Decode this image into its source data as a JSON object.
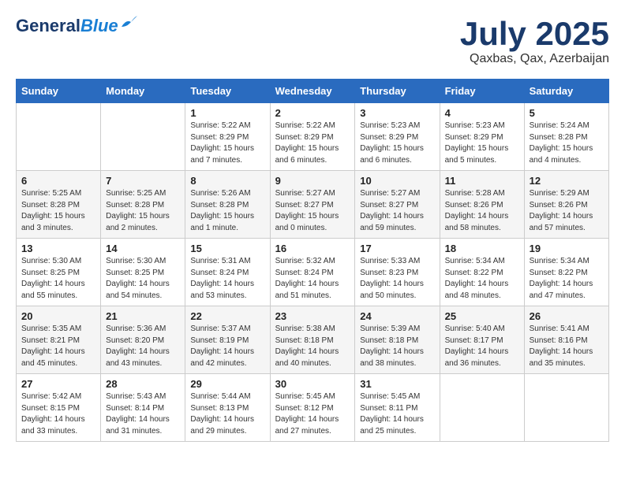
{
  "header": {
    "logo_line1": "General",
    "logo_line2": "Blue",
    "month": "July 2025",
    "location": "Qaxbas, Qax, Azerbaijan"
  },
  "weekdays": [
    "Sunday",
    "Monday",
    "Tuesday",
    "Wednesday",
    "Thursday",
    "Friday",
    "Saturday"
  ],
  "weeks": [
    [
      {
        "day": "",
        "text": ""
      },
      {
        "day": "",
        "text": ""
      },
      {
        "day": "1",
        "text": "Sunrise: 5:22 AM\nSunset: 8:29 PM\nDaylight: 15 hours and 7 minutes."
      },
      {
        "day": "2",
        "text": "Sunrise: 5:22 AM\nSunset: 8:29 PM\nDaylight: 15 hours and 6 minutes."
      },
      {
        "day": "3",
        "text": "Sunrise: 5:23 AM\nSunset: 8:29 PM\nDaylight: 15 hours and 6 minutes."
      },
      {
        "day": "4",
        "text": "Sunrise: 5:23 AM\nSunset: 8:29 PM\nDaylight: 15 hours and 5 minutes."
      },
      {
        "day": "5",
        "text": "Sunrise: 5:24 AM\nSunset: 8:28 PM\nDaylight: 15 hours and 4 minutes."
      }
    ],
    [
      {
        "day": "6",
        "text": "Sunrise: 5:25 AM\nSunset: 8:28 PM\nDaylight: 15 hours and 3 minutes."
      },
      {
        "day": "7",
        "text": "Sunrise: 5:25 AM\nSunset: 8:28 PM\nDaylight: 15 hours and 2 minutes."
      },
      {
        "day": "8",
        "text": "Sunrise: 5:26 AM\nSunset: 8:28 PM\nDaylight: 15 hours and 1 minute."
      },
      {
        "day": "9",
        "text": "Sunrise: 5:27 AM\nSunset: 8:27 PM\nDaylight: 15 hours and 0 minutes."
      },
      {
        "day": "10",
        "text": "Sunrise: 5:27 AM\nSunset: 8:27 PM\nDaylight: 14 hours and 59 minutes."
      },
      {
        "day": "11",
        "text": "Sunrise: 5:28 AM\nSunset: 8:26 PM\nDaylight: 14 hours and 58 minutes."
      },
      {
        "day": "12",
        "text": "Sunrise: 5:29 AM\nSunset: 8:26 PM\nDaylight: 14 hours and 57 minutes."
      }
    ],
    [
      {
        "day": "13",
        "text": "Sunrise: 5:30 AM\nSunset: 8:25 PM\nDaylight: 14 hours and 55 minutes."
      },
      {
        "day": "14",
        "text": "Sunrise: 5:30 AM\nSunset: 8:25 PM\nDaylight: 14 hours and 54 minutes."
      },
      {
        "day": "15",
        "text": "Sunrise: 5:31 AM\nSunset: 8:24 PM\nDaylight: 14 hours and 53 minutes."
      },
      {
        "day": "16",
        "text": "Sunrise: 5:32 AM\nSunset: 8:24 PM\nDaylight: 14 hours and 51 minutes."
      },
      {
        "day": "17",
        "text": "Sunrise: 5:33 AM\nSunset: 8:23 PM\nDaylight: 14 hours and 50 minutes."
      },
      {
        "day": "18",
        "text": "Sunrise: 5:34 AM\nSunset: 8:22 PM\nDaylight: 14 hours and 48 minutes."
      },
      {
        "day": "19",
        "text": "Sunrise: 5:34 AM\nSunset: 8:22 PM\nDaylight: 14 hours and 47 minutes."
      }
    ],
    [
      {
        "day": "20",
        "text": "Sunrise: 5:35 AM\nSunset: 8:21 PM\nDaylight: 14 hours and 45 minutes."
      },
      {
        "day": "21",
        "text": "Sunrise: 5:36 AM\nSunset: 8:20 PM\nDaylight: 14 hours and 43 minutes."
      },
      {
        "day": "22",
        "text": "Sunrise: 5:37 AM\nSunset: 8:19 PM\nDaylight: 14 hours and 42 minutes."
      },
      {
        "day": "23",
        "text": "Sunrise: 5:38 AM\nSunset: 8:18 PM\nDaylight: 14 hours and 40 minutes."
      },
      {
        "day": "24",
        "text": "Sunrise: 5:39 AM\nSunset: 8:18 PM\nDaylight: 14 hours and 38 minutes."
      },
      {
        "day": "25",
        "text": "Sunrise: 5:40 AM\nSunset: 8:17 PM\nDaylight: 14 hours and 36 minutes."
      },
      {
        "day": "26",
        "text": "Sunrise: 5:41 AM\nSunset: 8:16 PM\nDaylight: 14 hours and 35 minutes."
      }
    ],
    [
      {
        "day": "27",
        "text": "Sunrise: 5:42 AM\nSunset: 8:15 PM\nDaylight: 14 hours and 33 minutes."
      },
      {
        "day": "28",
        "text": "Sunrise: 5:43 AM\nSunset: 8:14 PM\nDaylight: 14 hours and 31 minutes."
      },
      {
        "day": "29",
        "text": "Sunrise: 5:44 AM\nSunset: 8:13 PM\nDaylight: 14 hours and 29 minutes."
      },
      {
        "day": "30",
        "text": "Sunrise: 5:45 AM\nSunset: 8:12 PM\nDaylight: 14 hours and 27 minutes."
      },
      {
        "day": "31",
        "text": "Sunrise: 5:45 AM\nSunset: 8:11 PM\nDaylight: 14 hours and 25 minutes."
      },
      {
        "day": "",
        "text": ""
      },
      {
        "day": "",
        "text": ""
      }
    ]
  ]
}
